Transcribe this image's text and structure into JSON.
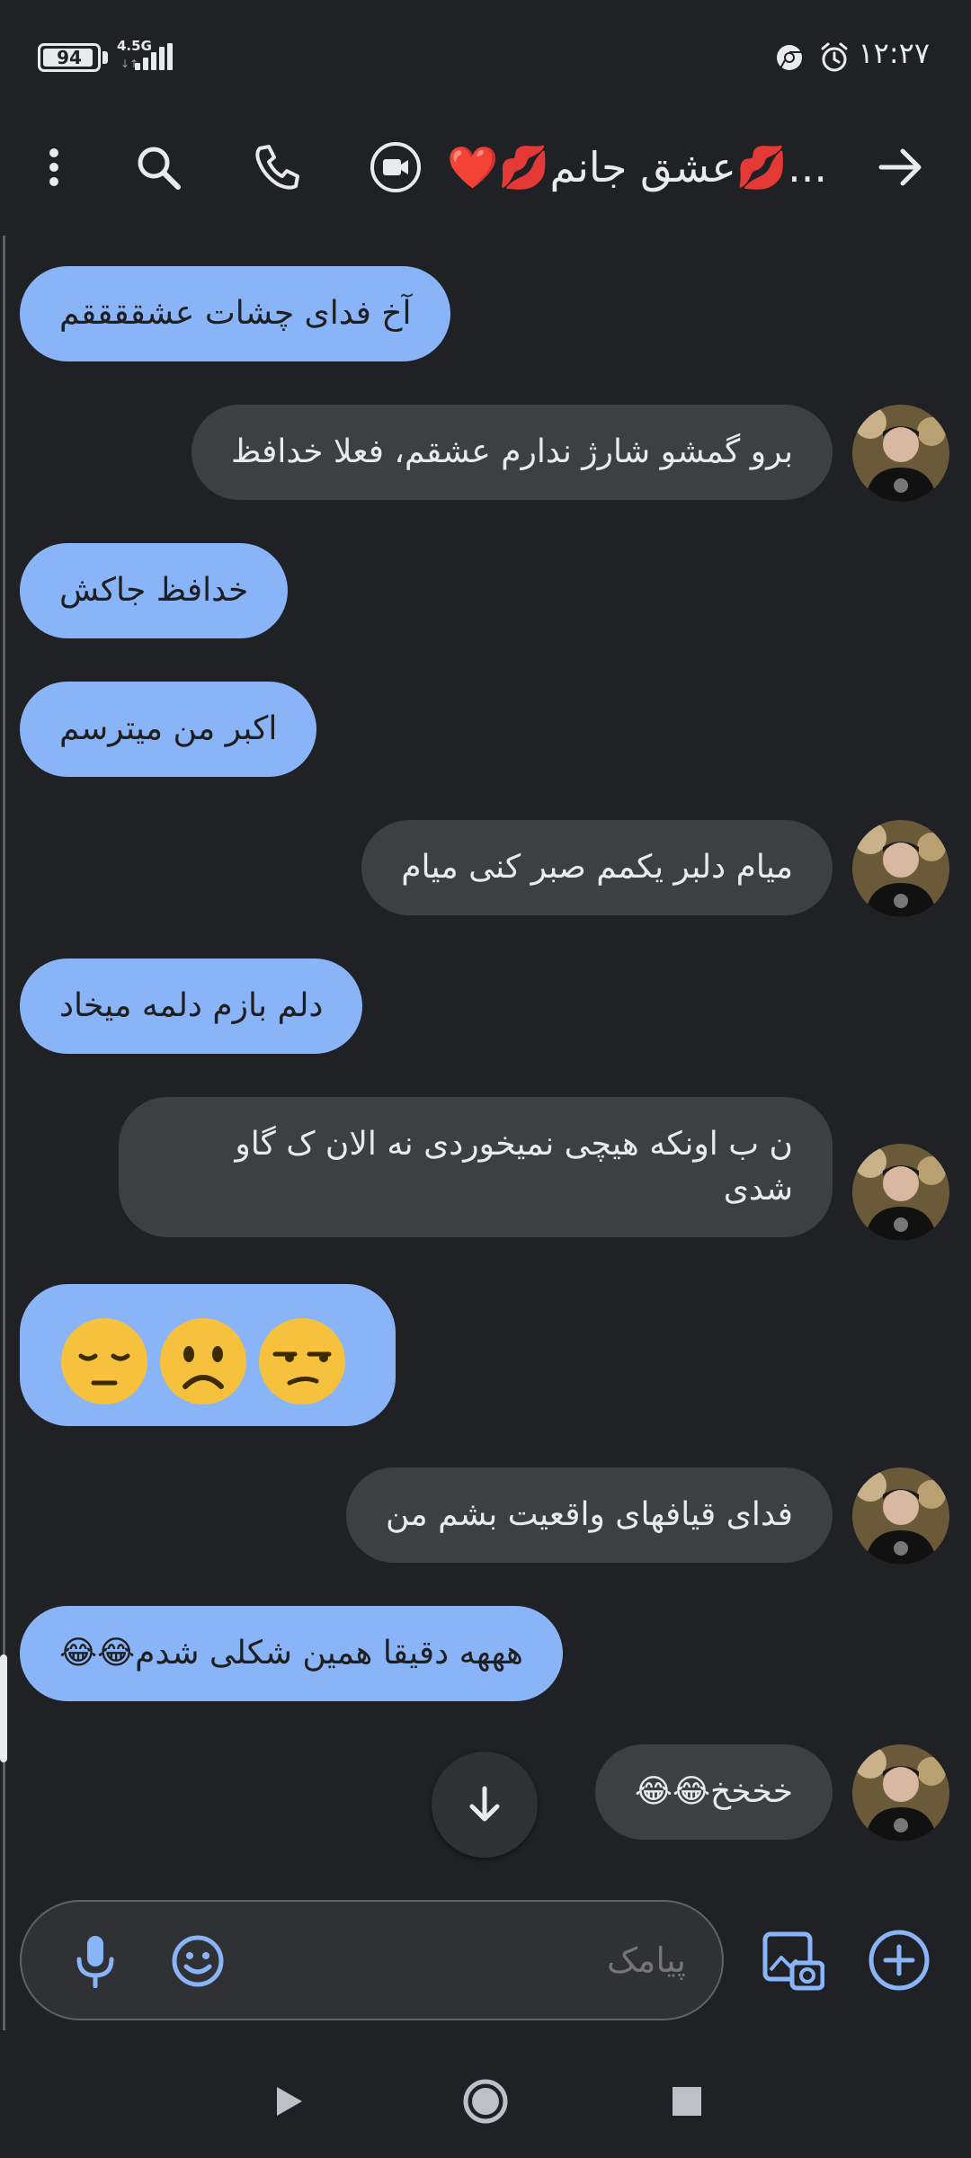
{
  "status_bar": {
    "time": "۱۲:۲۷",
    "battery_level": "94",
    "battery_fraction": 0.94,
    "network_type": "4.5G",
    "network_arrows": "↓↑"
  },
  "app_bar": {
    "contact_name": "...💋عشق جانم💋❤️"
  },
  "messages": [
    {
      "direction": "outgoing",
      "text": "آخ فدای چشات عشققققم"
    },
    {
      "direction": "incoming",
      "text": "برو گمشو شارژ ندارم عشقم، فعلا خدافظ"
    },
    {
      "direction": "outgoing",
      "text": "خدافظ جاکش"
    },
    {
      "direction": "outgoing",
      "text": "اکبر من میترسم"
    },
    {
      "direction": "incoming",
      "text": "میام دلبر یکمم صبر کنی میام"
    },
    {
      "direction": "outgoing",
      "text": "دلم بازم دلمه میخاد"
    },
    {
      "direction": "incoming",
      "text": "ن ب اونکه هیچی نمیخوردی نه الان ک گاو شدی"
    },
    {
      "direction": "outgoing",
      "text": "😒☹️😔"
    },
    {
      "direction": "incoming",
      "text": "فدای قیافهای واقعیت بشم من"
    },
    {
      "direction": "outgoing",
      "text": "هههه دقیقا همین شکلی شدم😂😂"
    },
    {
      "direction": "incoming",
      "text": "خخخخ😂😂"
    }
  ],
  "composer": {
    "placeholder": "پیامک"
  },
  "icons": {
    "back": "arrow-right-icon",
    "video": "video-call-icon",
    "call": "phone-icon",
    "search": "search-icon",
    "more": "more-vert-icon",
    "scroll_down": "arrow-down-icon",
    "mic": "mic-icon",
    "emoji": "emoji-icon",
    "gallery": "gallery-camera-icon",
    "add": "add-circle-icon"
  },
  "colors": {
    "background": "#202124",
    "outgoing_bubble": "#8ab4f8",
    "incoming_bubble": "#3c4043",
    "accent": "#8ab4f8"
  }
}
